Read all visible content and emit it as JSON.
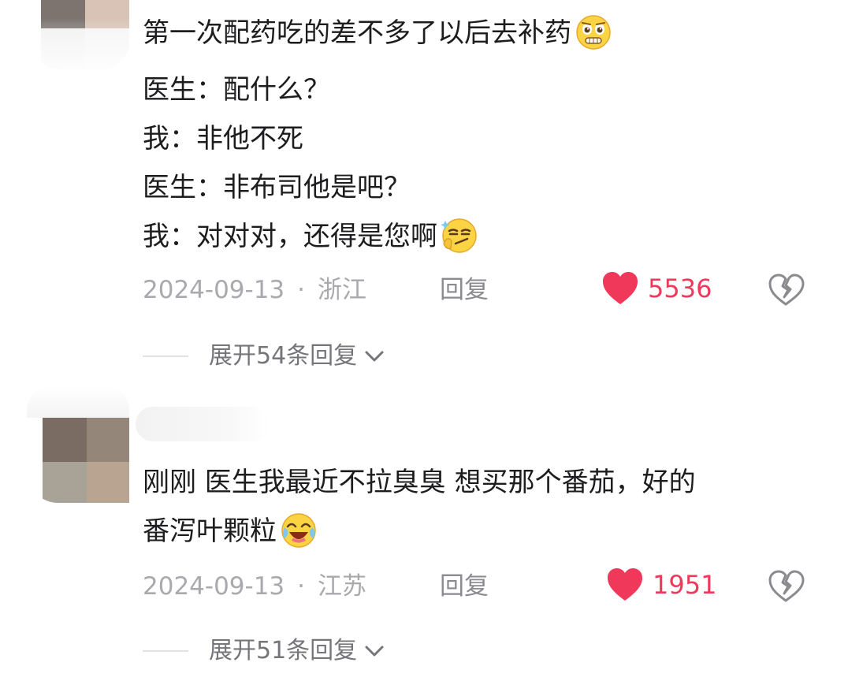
{
  "comments": [
    {
      "lines": [
        "第一次配药吃的差不多了以后去补药",
        "医生：配什么？",
        "我：非他不死",
        "医生：非布司他是吧？",
        "我：对对对，还得是您啊"
      ],
      "emojis": [
        "pleading-grimace-emoji",
        "smirk-thinking-emoji"
      ],
      "date": "2024-09-13",
      "separator": "·",
      "location": "浙江",
      "reply_label": "回复",
      "likes": "5536",
      "expand_label": "展开54条回复"
    },
    {
      "lines": [
        "刚刚 医生我最近不拉臭臭 想买那个番茄，好的",
        "番泻叶颗粒"
      ],
      "emojis": [
        "laughing-tears-emoji"
      ],
      "date": "2024-09-13",
      "separator": "·",
      "location": "江苏",
      "reply_label": "回复",
      "likes": "1951",
      "expand_label": "展开51条回复"
    }
  ],
  "colors": {
    "like": "#f0385a",
    "text": "#1d1d1f",
    "meta": "#a9a9ae"
  },
  "icons": {
    "like": "heart-icon",
    "dislike": "broken-heart-icon",
    "expand": "chevron-down-icon"
  }
}
